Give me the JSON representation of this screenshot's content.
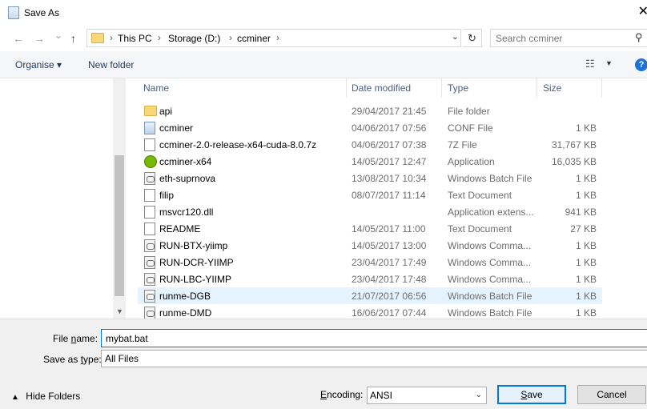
{
  "window": {
    "title": "Save As",
    "close_glyph": "✕"
  },
  "nav": {
    "back_glyph": "←",
    "forward_glyph": "→",
    "recent_glyph": "⌄",
    "up_glyph": "↑",
    "breadcrumb": [
      "This PC",
      "Storage (D:)",
      "ccminer"
    ],
    "separator": "›",
    "refresh_glyph": "↻",
    "search_placeholder": "Search ccminer",
    "search_glyph": "⚲"
  },
  "toolbar": {
    "organise_label": "Organise ▾",
    "new_folder_label": "New folder",
    "views_glyph": "☷",
    "views_drop_glyph": "▼",
    "help_glyph": "?"
  },
  "columns": {
    "name": "Name",
    "date": "Date modified",
    "type": "Type",
    "size": "Size",
    "sort_glyph": "^"
  },
  "files": [
    {
      "name": "api",
      "date": "29/04/2017 21:45",
      "type": "File folder",
      "size": "",
      "icon": "folder"
    },
    {
      "name": "ccminer",
      "date": "04/06/2017 07:56",
      "type": "CONF File",
      "size": "1 KB",
      "icon": "conf"
    },
    {
      "name": "ccminer-2.0-release-x64-cuda-8.0.7z",
      "date": "04/06/2017 07:38",
      "type": "7Z File",
      "size": "31,767 KB",
      "icon": "doc"
    },
    {
      "name": "ccminer-x64",
      "date": "14/05/2017 12:47",
      "type": "Application",
      "size": "16,035 KB",
      "icon": "nvidia"
    },
    {
      "name": "eth-suprnova",
      "date": "13/08/2017 10:34",
      "type": "Windows Batch File",
      "size": "1 KB",
      "icon": "batch"
    },
    {
      "name": "filip",
      "date": "08/07/2017 11:14",
      "type": "Text Document",
      "size": "1 KB",
      "icon": "doc"
    },
    {
      "name": "msvcr120.dll",
      "date": "",
      "type": "Application extens...",
      "size": "941 KB",
      "icon": "dll"
    },
    {
      "name": "README",
      "date": "14/05/2017 11:00",
      "type": "Text Document",
      "size": "27 KB",
      "icon": "doc"
    },
    {
      "name": "RUN-BTX-yiimp",
      "date": "14/05/2017 13:00",
      "type": "Windows Comma...",
      "size": "1 KB",
      "icon": "batch"
    },
    {
      "name": "RUN-DCR-YIIMP",
      "date": "23/04/2017 17:49",
      "type": "Windows Comma...",
      "size": "1 KB",
      "icon": "batch"
    },
    {
      "name": "RUN-LBC-YIIMP",
      "date": "23/04/2017 17:48",
      "type": "Windows Comma...",
      "size": "1 KB",
      "icon": "batch"
    },
    {
      "name": "runme-DGB",
      "date": "21/07/2017 06:56",
      "type": "Windows Batch File",
      "size": "1 KB",
      "icon": "batch"
    },
    {
      "name": "runme-DMD",
      "date": "16/06/2017 07:44",
      "type": "Windows Batch File",
      "size": "1 KB",
      "icon": "batch"
    }
  ],
  "form": {
    "file_name_label": "File name:",
    "file_name_value": "mybat.bat",
    "save_type_label": "Save as type:",
    "save_type_value": "All Files",
    "hide_folders_label": "Hide Folders",
    "hide_folders_glyph": "▲",
    "encoding_label": "Encoding:",
    "encoding_value": "ANSI",
    "encoding_drop_glyph": "⌄",
    "save_label": "Save",
    "cancel_label": "Cancel"
  },
  "colors": {
    "accent": "#0078d7",
    "selected_row": "#e5f3ff",
    "folder": "#f8d775",
    "nvidia": "#76b900"
  }
}
